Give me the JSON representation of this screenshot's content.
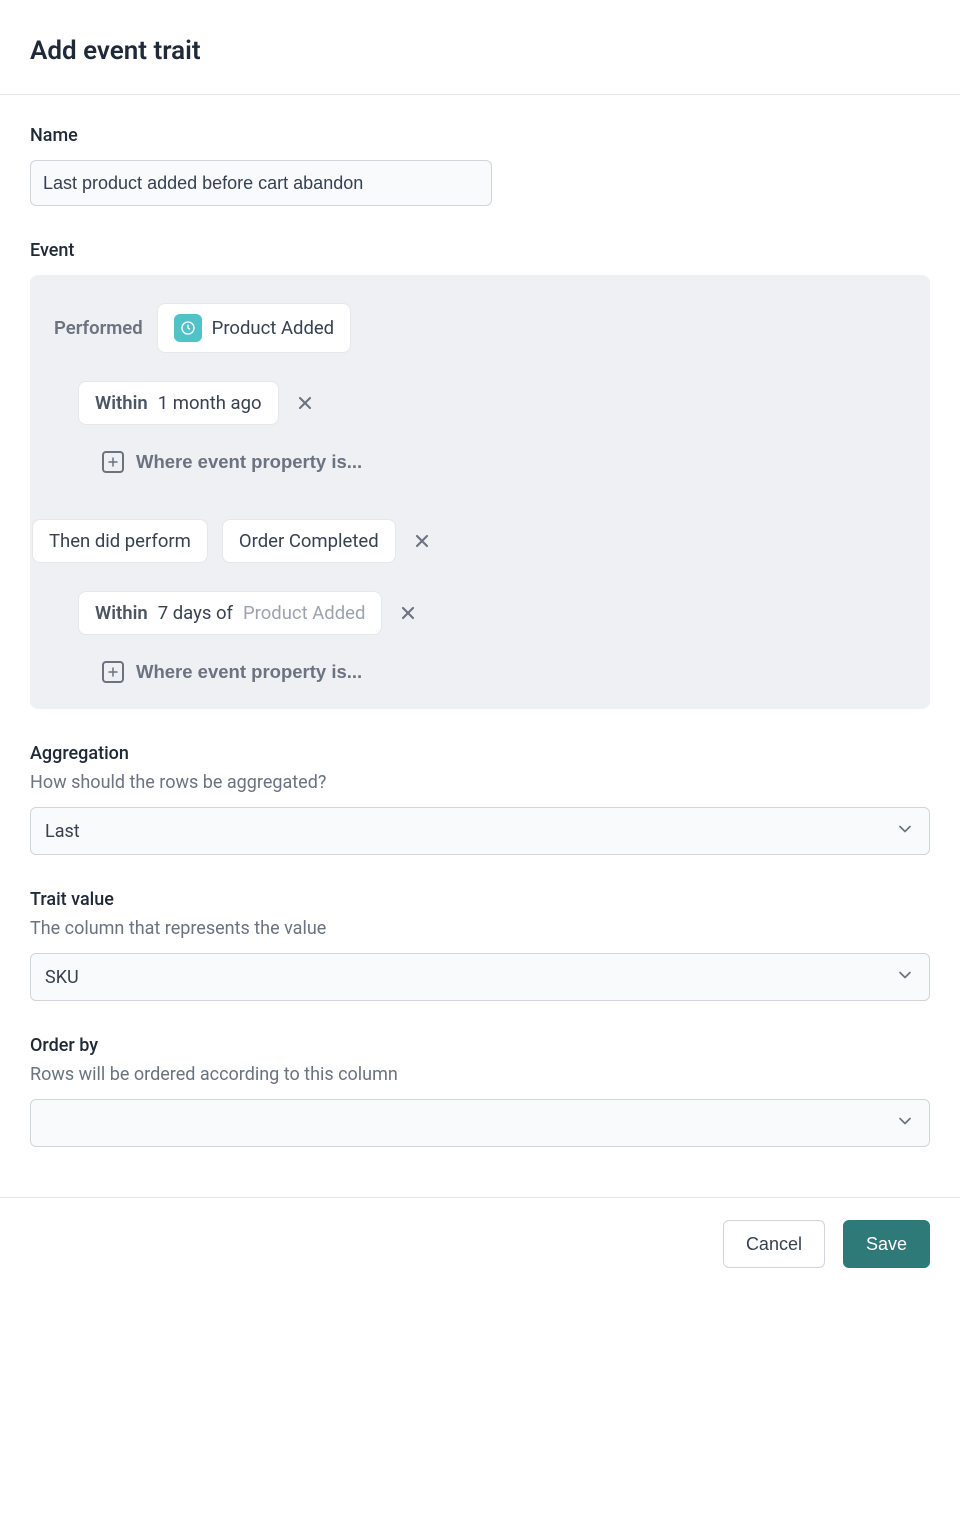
{
  "header": {
    "title": "Add event trait"
  },
  "name": {
    "label": "Name",
    "value": "Last product added before cart abandon"
  },
  "event": {
    "label": "Event",
    "performed_label": "Performed",
    "event_name": "Product Added",
    "within1_prefix": "Within",
    "within1_value": "1 month ago",
    "where_property_label": "Where event property is...",
    "then_label": "Then did perform",
    "second_event": "Order Completed",
    "within2_prefix": "Within",
    "within2_value": "7 days of",
    "within2_ref": "Product Added"
  },
  "aggregation": {
    "label": "Aggregation",
    "help": "How should the rows be aggregated?",
    "value": "Last"
  },
  "trait_value": {
    "label": "Trait value",
    "help": "The column that represents the value",
    "value": "SKU"
  },
  "order_by": {
    "label": "Order by",
    "help": "Rows will be ordered according to this column",
    "value": ""
  },
  "footer": {
    "cancel": "Cancel",
    "save": "Save"
  }
}
